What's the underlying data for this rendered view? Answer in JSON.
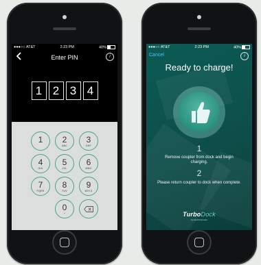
{
  "phones": [
    {
      "status": {
        "carrier": "●●●○○ AT&T",
        "time": "2:23 PM",
        "battery": "40%"
      },
      "nav": {
        "back_icon": "chevron-left-icon",
        "title": "Enter PIN",
        "info_icon": "info-icon"
      },
      "pin_digits": [
        "1",
        "2",
        "3",
        "4"
      ],
      "keys": [
        {
          "n": "1",
          "l": ""
        },
        {
          "n": "2",
          "l": "ABC"
        },
        {
          "n": "3",
          "l": "DEF"
        },
        {
          "n": "4",
          "l": "GHI"
        },
        {
          "n": "5",
          "l": "JKL"
        },
        {
          "n": "6",
          "l": "MNO"
        },
        {
          "n": "7",
          "l": "PQRS"
        },
        {
          "n": "8",
          "l": "TUV"
        },
        {
          "n": "9",
          "l": "WXYZ"
        },
        {
          "n": "0",
          "l": "+"
        }
      ],
      "delete_icon": "backspace-icon"
    },
    {
      "status": {
        "carrier": "●●●○○ AT&T",
        "time": "2:23 PM",
        "battery": "40%"
      },
      "cancel_label": "Cancel",
      "info_icon": "info-icon",
      "title": "Ready to charge!",
      "thumb_icon": "thumbs-up-icon",
      "steps": [
        {
          "number": "1",
          "text": "Remove coupler from dock and begin charging."
        },
        {
          "number": "2",
          "text": "Please return coupler to dock when complete."
        }
      ],
      "logo": {
        "brand_a": "Turbo",
        "brand_b": "Dock",
        "tagline": "by AeroVironment"
      }
    }
  ],
  "colors": {
    "key_ring": "#4aa386",
    "screen2_bg": "#0b5b55",
    "cancel_link": "#4fc3ff"
  }
}
